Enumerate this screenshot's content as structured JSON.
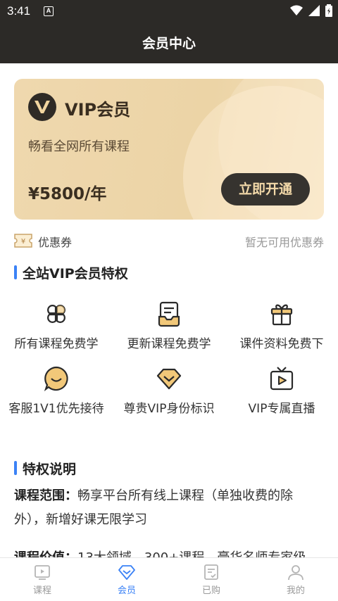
{
  "status_bar": {
    "time": "3:41",
    "notification": "A"
  },
  "header": {
    "title": "会员中心"
  },
  "vip_card": {
    "title": "VIP会员",
    "description": "畅看全网所有课程",
    "price": "¥5800/年",
    "button": "立即开通"
  },
  "coupon": {
    "label": "优惠券",
    "status": "暂无可用优惠券"
  },
  "privileges": {
    "title": "全站VIP会员特权",
    "items": [
      {
        "label": "所有课程免费学",
        "icon": "clover-icon"
      },
      {
        "label": "更新课程免费学",
        "icon": "inbox-icon"
      },
      {
        "label": "课件资料免费下",
        "icon": "gift-icon"
      },
      {
        "label": "客服1V1优先接待",
        "icon": "chat-smile-icon"
      },
      {
        "label": "尊贵VIP身份标识",
        "icon": "diamond-icon"
      },
      {
        "label": "VIP专属直播",
        "icon": "tv-play-icon"
      }
    ]
  },
  "explanation": {
    "title": "特权说明",
    "para1_key": "课程范围：",
    "para1_text": "畅享平台所有线上课程（单独收费的除外），新增好课无限学习",
    "para2_key": "课程价值：",
    "para2_text": "13大领域，300+课程，豪华名师专家级"
  },
  "tabs": [
    {
      "label": "课程",
      "icon": "course-icon",
      "active": false
    },
    {
      "label": "会员",
      "icon": "diamond-icon",
      "active": true
    },
    {
      "label": "已购",
      "icon": "purchased-icon",
      "active": false
    },
    {
      "label": "我的",
      "icon": "profile-icon",
      "active": false
    }
  ],
  "colors": {
    "header_bg": "#2c2a27",
    "card_gold": "#ecd4a6",
    "accent_blue": "#3b82f6",
    "button_dark": "#36332f"
  }
}
